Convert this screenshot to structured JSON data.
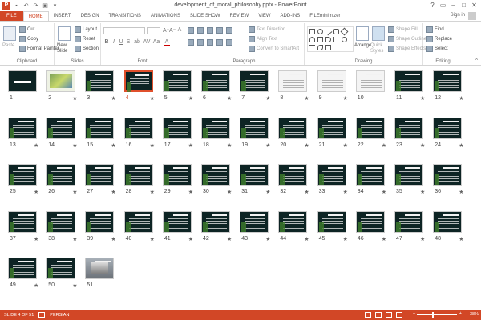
{
  "window": {
    "title": "development_of_moral_philosophy.pptx - PowerPoint",
    "logo": "P",
    "controls": [
      "?",
      "▭",
      "–",
      "□",
      "✕"
    ],
    "sign_in": "Sign in"
  },
  "tabs": [
    "FILE",
    "HOME",
    "INSERT",
    "DESIGN",
    "TRANSITIONS",
    "ANIMATIONS",
    "SLIDE SHOW",
    "REVIEW",
    "VIEW",
    "ADD-INS",
    "FILEminimizer"
  ],
  "active_tab": "HOME",
  "ribbon": {
    "clipboard": {
      "label": "Clipboard",
      "paste": "Paste",
      "cut": "Cut",
      "copy": "Copy",
      "format_painter": "Format Painter"
    },
    "slides": {
      "label": "Slides",
      "new_slide": "New Slide",
      "layout": "Layout",
      "reset": "Reset",
      "section": "Section"
    },
    "font": {
      "label": "Font",
      "size_up": "A⁺",
      "size_down": "A⁻",
      "clear": "A",
      "bold": "B",
      "italic": "I",
      "underline": "U",
      "strike": "S",
      "shadow": "ab",
      "spacing": "AV",
      "case": "Aa",
      "color": "A"
    },
    "paragraph": {
      "label": "Paragraph",
      "text_direction": "Text Direction",
      "align_text": "Align Text",
      "smartart": "Convert to SmartArt"
    },
    "drawing": {
      "label": "Drawing",
      "arrange": "Arrange",
      "quick_styles": "Quick Styles",
      "shape_fill": "Shape Fill",
      "shape_outline": "Shape Outline",
      "shape_effects": "Shape Effects"
    },
    "editing": {
      "label": "Editing",
      "find": "Find",
      "replace": "Replace",
      "select": "Select"
    }
  },
  "slides": [
    {
      "n": "1",
      "star": ""
    },
    {
      "n": "2",
      "star": "★"
    },
    {
      "n": "3",
      "star": "★"
    },
    {
      "n": "4",
      "star": "★"
    },
    {
      "n": "5",
      "star": "★"
    },
    {
      "n": "6",
      "star": "★"
    },
    {
      "n": "7",
      "star": "★"
    },
    {
      "n": "8",
      "star": "★"
    },
    {
      "n": "9",
      "star": "★"
    },
    {
      "n": "10",
      "star": ""
    },
    {
      "n": "11",
      "star": "★"
    },
    {
      "n": "12",
      "star": "★"
    },
    {
      "n": "13",
      "star": "★"
    },
    {
      "n": "14",
      "star": "★"
    },
    {
      "n": "15",
      "star": "★"
    },
    {
      "n": "16",
      "star": "★"
    },
    {
      "n": "17",
      "star": "★"
    },
    {
      "n": "18",
      "star": "★"
    },
    {
      "n": "19",
      "star": "★"
    },
    {
      "n": "20",
      "star": "★"
    },
    {
      "n": "21",
      "star": "★"
    },
    {
      "n": "22",
      "star": "★"
    },
    {
      "n": "23",
      "star": "★"
    },
    {
      "n": "24",
      "star": "★"
    },
    {
      "n": "25",
      "star": "★"
    },
    {
      "n": "26",
      "star": "★"
    },
    {
      "n": "27",
      "star": "★"
    },
    {
      "n": "28",
      "star": "★"
    },
    {
      "n": "29",
      "star": "★"
    },
    {
      "n": "30",
      "star": "★"
    },
    {
      "n": "31",
      "star": "★"
    },
    {
      "n": "32",
      "star": "★"
    },
    {
      "n": "33",
      "star": "★"
    },
    {
      "n": "34",
      "star": "★"
    },
    {
      "n": "35",
      "star": "★"
    },
    {
      "n": "36",
      "star": "★"
    },
    {
      "n": "37",
      "star": "★"
    },
    {
      "n": "38",
      "star": "★"
    },
    {
      "n": "39",
      "star": "★"
    },
    {
      "n": "40",
      "star": "★"
    },
    {
      "n": "41",
      "star": "★"
    },
    {
      "n": "42",
      "star": "★"
    },
    {
      "n": "43",
      "star": "★"
    },
    {
      "n": "44",
      "star": "★"
    },
    {
      "n": "45",
      "star": "★"
    },
    {
      "n": "46",
      "star": "★"
    },
    {
      "n": "47",
      "star": "★"
    },
    {
      "n": "48",
      "star": "★"
    },
    {
      "n": "49",
      "star": "★"
    },
    {
      "n": "50",
      "star": "★"
    },
    {
      "n": "51",
      "star": ""
    }
  ],
  "selected_slide": 4,
  "status": {
    "slide": "SLIDE 4 OF 51",
    "language": "PERSIAN",
    "zoom": "38%",
    "zoom_level": 0.38
  },
  "colors": {
    "accent": "#d24726",
    "slide_bg": "#0d2424"
  }
}
